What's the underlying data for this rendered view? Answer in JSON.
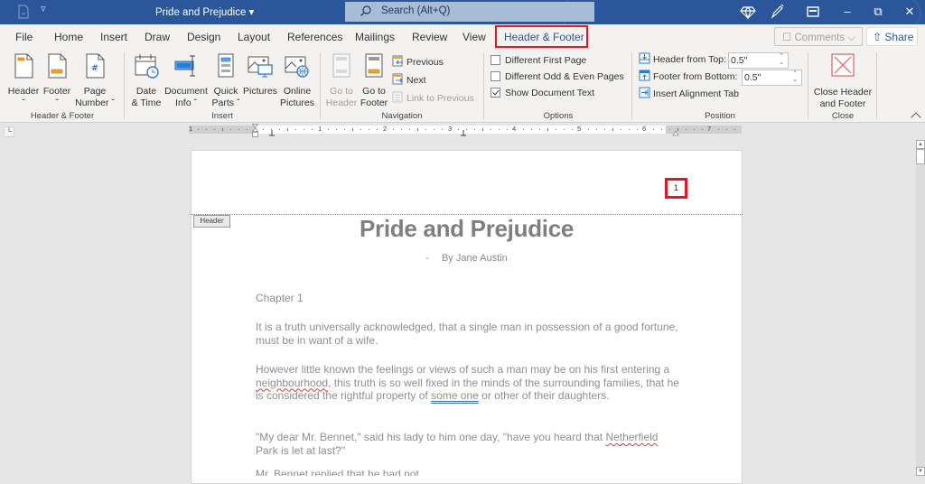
{
  "titlebar": {
    "doc_title": "Pride and Prejudice ▾",
    "search_placeholder": "Search (Alt+Q)",
    "customize_glyph": "▿",
    "controls": {
      "minimize": "–",
      "restore": "⧉",
      "close": "✕"
    }
  },
  "tabs": [
    {
      "label": "File"
    },
    {
      "label": "Home"
    },
    {
      "label": "Insert"
    },
    {
      "label": "Draw"
    },
    {
      "label": "Design"
    },
    {
      "label": "Layout"
    },
    {
      "label": "References"
    },
    {
      "label": "Mailings"
    },
    {
      "label": "Review"
    },
    {
      "label": "View"
    },
    {
      "label": "Header & Footer",
      "active": true
    }
  ],
  "top_right": {
    "comments_label": "☐ Comments ⌵",
    "share_label": "⇧ Share"
  },
  "ribbon": {
    "header_footer_group": {
      "label": "Header & Footer",
      "header_btn": {
        "line1": "Header",
        "line2": "ˇ"
      },
      "footer_btn": {
        "line1": "Footer",
        "line2": "ˇ"
      },
      "page_number_btn": {
        "line1": "Page",
        "line2": "Number ˇ"
      }
    },
    "insert_group": {
      "label": "Insert",
      "date_time": {
        "line1": "Date",
        "line2": "& Time"
      },
      "document_info": {
        "line1": "Document",
        "line2": "Info ˇ"
      },
      "quick_parts": {
        "line1": "Quick",
        "line2": "Parts ˇ"
      },
      "pictures": {
        "line1": "Pictures",
        "line2": ""
      },
      "online_pictures": {
        "line1": "Online",
        "line2": "Pictures"
      }
    },
    "navigation_group": {
      "label": "Navigation",
      "go_to_header": {
        "line1": "Go to",
        "line2": "Header"
      },
      "go_to_footer": {
        "line1": "Go to",
        "line2": "Footer"
      },
      "previous": "Previous",
      "next": "Next",
      "link_to_previous": "Link to Previous"
    },
    "options_group": {
      "label": "Options",
      "different_first_page": {
        "label": "Different First Page",
        "checked": false
      },
      "different_odd_even": {
        "label": "Different Odd & Even Pages",
        "checked": false
      },
      "show_document_text": {
        "label": "Show Document Text",
        "checked": true
      }
    },
    "position_group": {
      "label": "Position",
      "header_from_top": {
        "label": "Header from Top:",
        "value": "0.5\""
      },
      "footer_from_bottom": {
        "label": "Footer from Bottom:",
        "value": "0.5\""
      },
      "insert_alignment_tab": "Insert Alignment Tab"
    },
    "close_group": {
      "label": "Close",
      "close_btn": {
        "line1": "Close Header",
        "line2": "and Footer"
      }
    }
  },
  "ruler": {
    "corner_glyph": "└",
    "numbers": [
      "1",
      "1",
      "2",
      "3",
      "4",
      "5",
      "6",
      "7"
    ]
  },
  "document": {
    "page_number": "1",
    "header_tag": "Header",
    "title": "Pride and Prejudice",
    "subtitle_dash": "-",
    "subtitle": "By Jane Austin",
    "chapter": "Chapter 1",
    "p1": "It is a truth universally acknowledged, that a single man in possession of a good fortune, must be in want of a wife.",
    "p2": {
      "a": "However little known the feelings or views of such a man may be on his first entering a ",
      "spell1": "neighbourhood",
      "b": ", this truth is so well fixed in the minds of the surrounding families, that he is considered the rightful property of ",
      "gram1": "some one",
      "c": " or other of their daughters."
    },
    "p3": {
      "a": "\"My dear Mr. Bennet,\" said his lady to him one day, \"have you heard that ",
      "spell1": "Netherfield",
      "b": " Park is let at last?\""
    },
    "p4_cut": "Mr. Bennet replied that he had not."
  },
  "colors": {
    "title_bar": "#2b579a",
    "accent": "#2b579a",
    "highlight_box": "#e8141f",
    "ribbon_bg": "#f3f2f1",
    "doc_text": "#8f8f8f"
  }
}
